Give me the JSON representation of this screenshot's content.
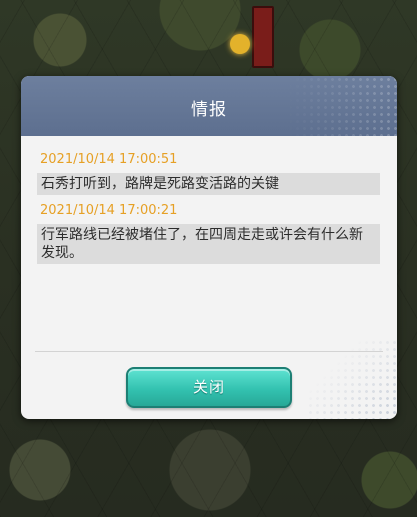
{
  "dialog": {
    "title": "情报",
    "entries": [
      {
        "time": "2021/10/14 17:00:51",
        "message": "石秀打听到，路牌是死路变活路的关键"
      },
      {
        "time": "2021/10/14 17:00:21",
        "message": "行军路线已经被堵住了，在四周走走或许会有什么新发现。"
      }
    ],
    "close_label": "关闭"
  },
  "colors": {
    "header": "#6d7f9e",
    "timestamp": "#e6a025",
    "button": "#33c2b0"
  }
}
